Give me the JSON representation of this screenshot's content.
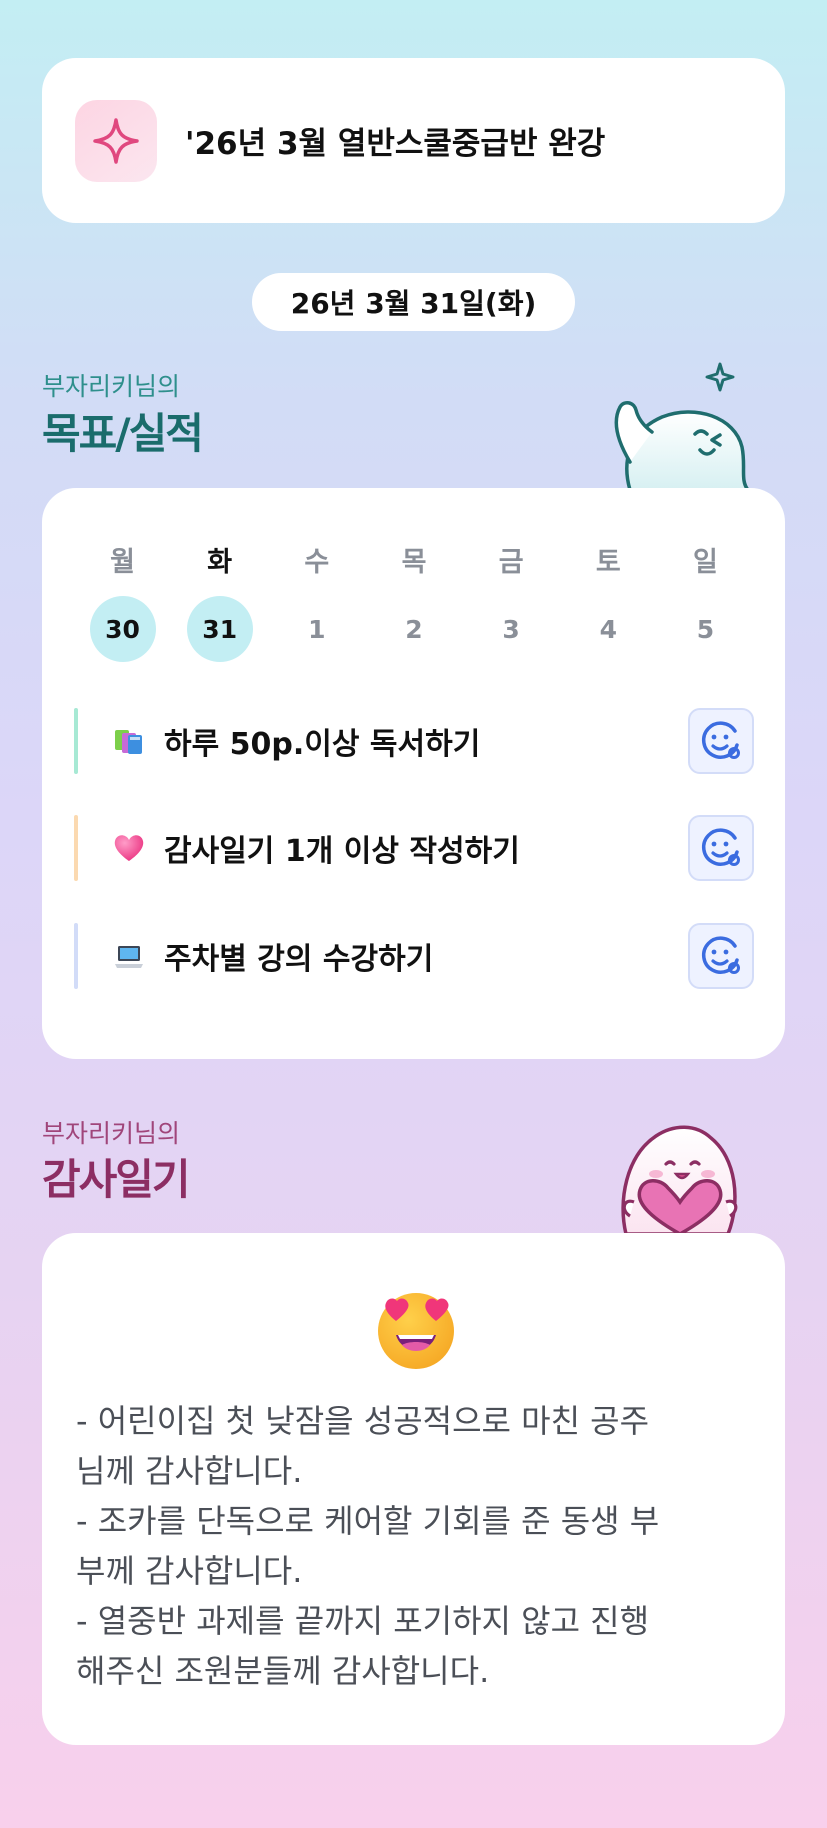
{
  "banner": {
    "icon": "sparkle-icon",
    "title": "'26년 3월 열반스쿨중급반 완강"
  },
  "date_label": "26년 3월 31일(화)",
  "goals_section": {
    "subtitle": "부자리키님의",
    "title": "목표/실적"
  },
  "calendar": {
    "weekdays": [
      "월",
      "화",
      "수",
      "목",
      "금",
      "토",
      "일"
    ],
    "days": [
      "30",
      "31",
      "1",
      "2",
      "3",
      "4",
      "5"
    ],
    "highlighted_indices": [
      0,
      1
    ],
    "selected_weekday_index": 1
  },
  "goals": [
    {
      "emoji": "books-icon",
      "label": "하루 50p.이상 독서하기",
      "bar_color": "#a7e9d4"
    },
    {
      "emoji": "heart-icon",
      "label": "감사일기 1개 이상 작성하기",
      "bar_color": "#fbd9b0"
    },
    {
      "emoji": "laptop-icon",
      "label": "주차별 강의 수강하기",
      "bar_color": "#d2dcf8"
    }
  ],
  "diary_section": {
    "subtitle": "부자리키님의",
    "title": "감사일기"
  },
  "diary": {
    "emoji": "heart-eyes-emoji-icon",
    "lines": [
      "- 어린이집 첫 낮잠을 성공적으로 마친 공주",
      "님께 감사합니다.",
      "- 조카를 단독으로 케어할 기회를 준 동생 부",
      "부께 감사합니다.",
      "- 열중반 과제를 끝까지 포기하지 않고 진행",
      "해주신 조원분들께 감사합니다."
    ]
  },
  "colors": {
    "goal_heading": "#1a6c6c",
    "diary_heading": "#8c2e63",
    "highlight_circle": "#c3eef3",
    "emoji_button_icon": "#3b6ce0"
  }
}
